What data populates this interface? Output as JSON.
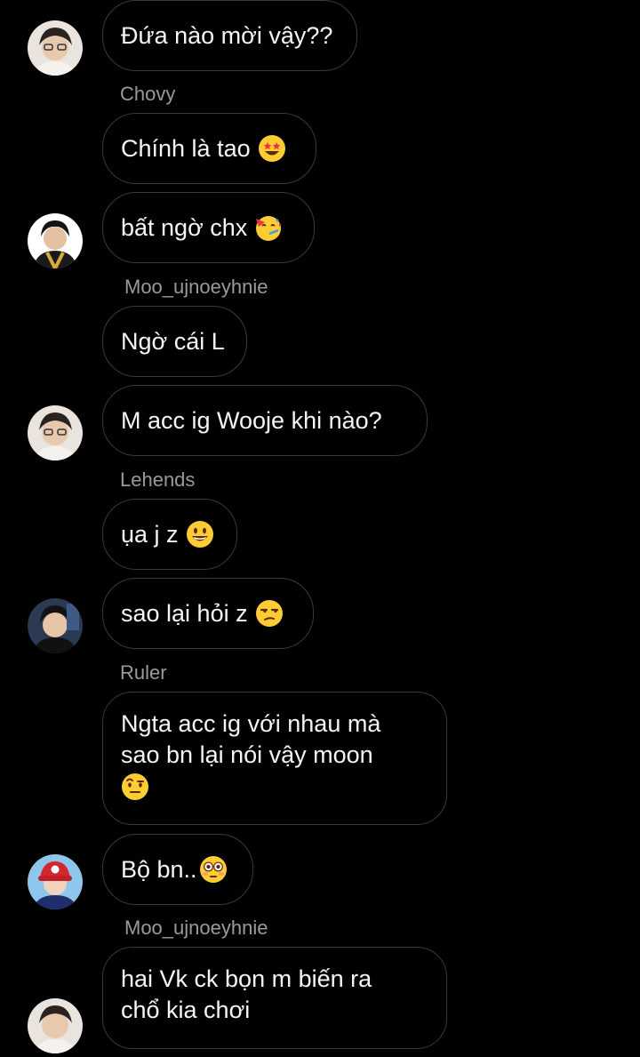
{
  "messages": [
    {
      "text": "Đứa nào mời vậy??"
    },
    {
      "sender": "Chovy",
      "text": "Chính là tao",
      "emoji": "star-struck-emoji"
    },
    {
      "text": "bất ngờ chx",
      "emoji": "partying-face-emoji"
    },
    {
      "sender": "Moo_ujnoeyhnie",
      "text": "Ngờ cái L"
    },
    {
      "text": "M acc ig Wooje khi nào?"
    },
    {
      "sender": "Lehends",
      "text": "ụa j z",
      "emoji": "grinning-face-emoji"
    },
    {
      "text": "sao lại hỏi z",
      "emoji": "unamused-face-emoji"
    },
    {
      "sender": "Ruler",
      "lines": [
        "Ngta acc ig với nhau mà",
        "sao bn lại nói vậy moon"
      ],
      "emoji": "raised-eyebrow-emoji"
    },
    {
      "text": "Bộ bn..",
      "emoji": "flushed-face-emoji"
    },
    {
      "sender": "Moo_ujnoeyhnie",
      "lines": [
        "hai Vk ck bọn m biến ra",
        "chổ kia chơi"
      ]
    }
  ],
  "colors": {
    "background": "#000000",
    "bubble_border": "#3a3a3a",
    "sender_text": "#9a9a9a",
    "message_text": "#f5f5f5"
  }
}
